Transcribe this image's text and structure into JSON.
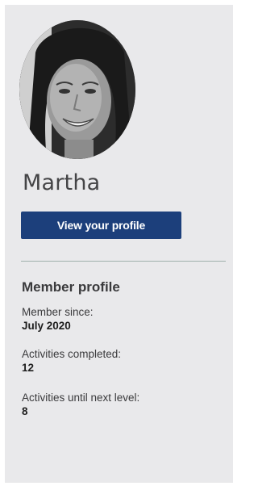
{
  "user": {
    "name": "Martha",
    "profile_button_label": "View your profile"
  },
  "member_profile": {
    "title": "Member profile",
    "stats": [
      {
        "label": "Member since:",
        "value": "July 2020"
      },
      {
        "label": "Activities completed:",
        "value": "12"
      },
      {
        "label": "Activities until next level:",
        "value": "8"
      }
    ]
  },
  "colors": {
    "panel_background": "#e9e9eb",
    "button_background": "#1c3f7b",
    "divider": "#9fb0ab"
  }
}
